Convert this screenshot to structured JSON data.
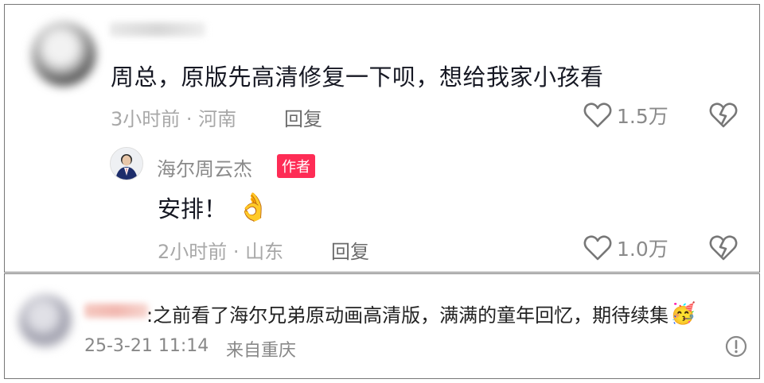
{
  "top_comment": {
    "text": "周总，原版先高清修复一下呗，想给我家小孩看",
    "meta": "3小时前 · 河南",
    "reply_label": "回复",
    "likes": "1.5万",
    "reply": {
      "author": "海尔周云杰",
      "author_badge": "作者",
      "text": "安排！",
      "emoji": "👌",
      "meta": "2小时前 · 山东",
      "reply_label": "回复",
      "likes": "1.0万"
    }
  },
  "bottom_comment": {
    "text": ":之前看了海尔兄弟原动画高清版，满满的童年回忆，期待续集",
    "emoji": "🥳",
    "timestamp": "25-3-21 11:14",
    "location": "来自重庆"
  },
  "colors": {
    "accent": "#fe2c55",
    "meta_gray": "#a8a8a8"
  }
}
